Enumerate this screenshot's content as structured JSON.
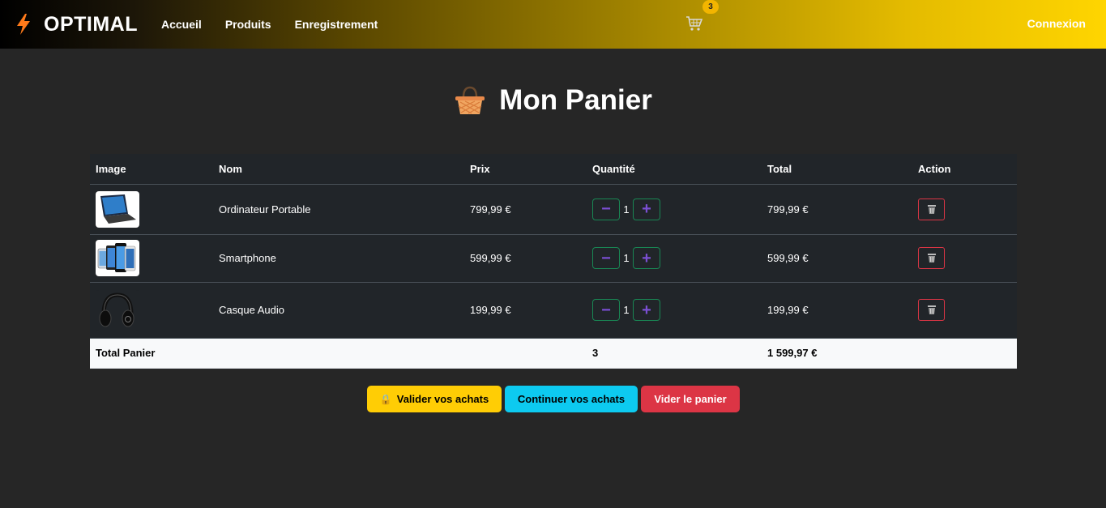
{
  "navbar": {
    "brand": "OPTIMAL",
    "links": [
      "Accueil",
      "Produits",
      "Enregistrement"
    ],
    "cart_count": "3",
    "login": "Connexion"
  },
  "page": {
    "title": "Mon Panier"
  },
  "table": {
    "headers": [
      "Image",
      "Nom",
      "Prix",
      "Quantité",
      "Total",
      "Action"
    ],
    "rows": [
      {
        "image_icon": "laptop-image",
        "name": "Ordinateur Portable",
        "price": "799,99 €",
        "quantity": "1",
        "total": "799,99 €"
      },
      {
        "image_icon": "smartphone-image",
        "name": "Smartphone",
        "price": "599,99 €",
        "quantity": "1",
        "total": "599,99 €"
      },
      {
        "image_icon": "headphones-image",
        "name": "Casque Audio",
        "price": "199,99 €",
        "quantity": "1",
        "total": "199,99 €"
      }
    ],
    "footer": {
      "label": "Total Panier",
      "quantity": "3",
      "total": "1 599,97 €"
    }
  },
  "actions": {
    "validate": "Valider vos achats",
    "continue": "Continuer vos achats",
    "clear": "Vider le panier"
  },
  "colors": {
    "accent_yellow": "#ffcd05",
    "info_cyan": "#0dcaf0",
    "danger_red": "#dc3545",
    "success_green": "#198754",
    "qty_purple": "#7b4fd4"
  }
}
